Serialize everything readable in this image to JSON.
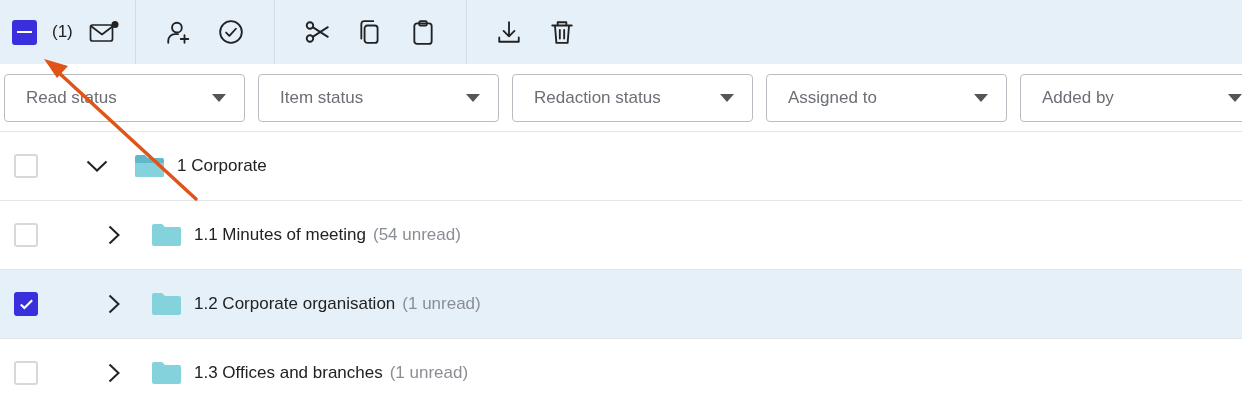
{
  "toolbar": {
    "select_all": {
      "indeterminate": true
    },
    "selected_count": "(1)"
  },
  "filters": [
    {
      "placeholder": "Read status"
    },
    {
      "placeholder": "Item status"
    },
    {
      "placeholder": "Redaction status"
    },
    {
      "placeholder": "Assigned to"
    },
    {
      "placeholder": "Added by"
    }
  ],
  "tree": [
    {
      "label": "1 Corporate",
      "checked": false,
      "selected": false,
      "expanded": true,
      "children": [
        {
          "label": "1.1 Minutes of meeting",
          "unread": "(54 unread)",
          "checked": false,
          "selected": false,
          "expanded": false
        },
        {
          "label": "1.2 Corporate organisation",
          "unread": "(1 unread)",
          "checked": true,
          "selected": true,
          "expanded": false
        },
        {
          "label": "1.3 Offices and branches",
          "unread": "(1 unread)",
          "checked": false,
          "selected": false,
          "expanded": false
        }
      ]
    }
  ],
  "annotation": {
    "kind": "arrow"
  }
}
